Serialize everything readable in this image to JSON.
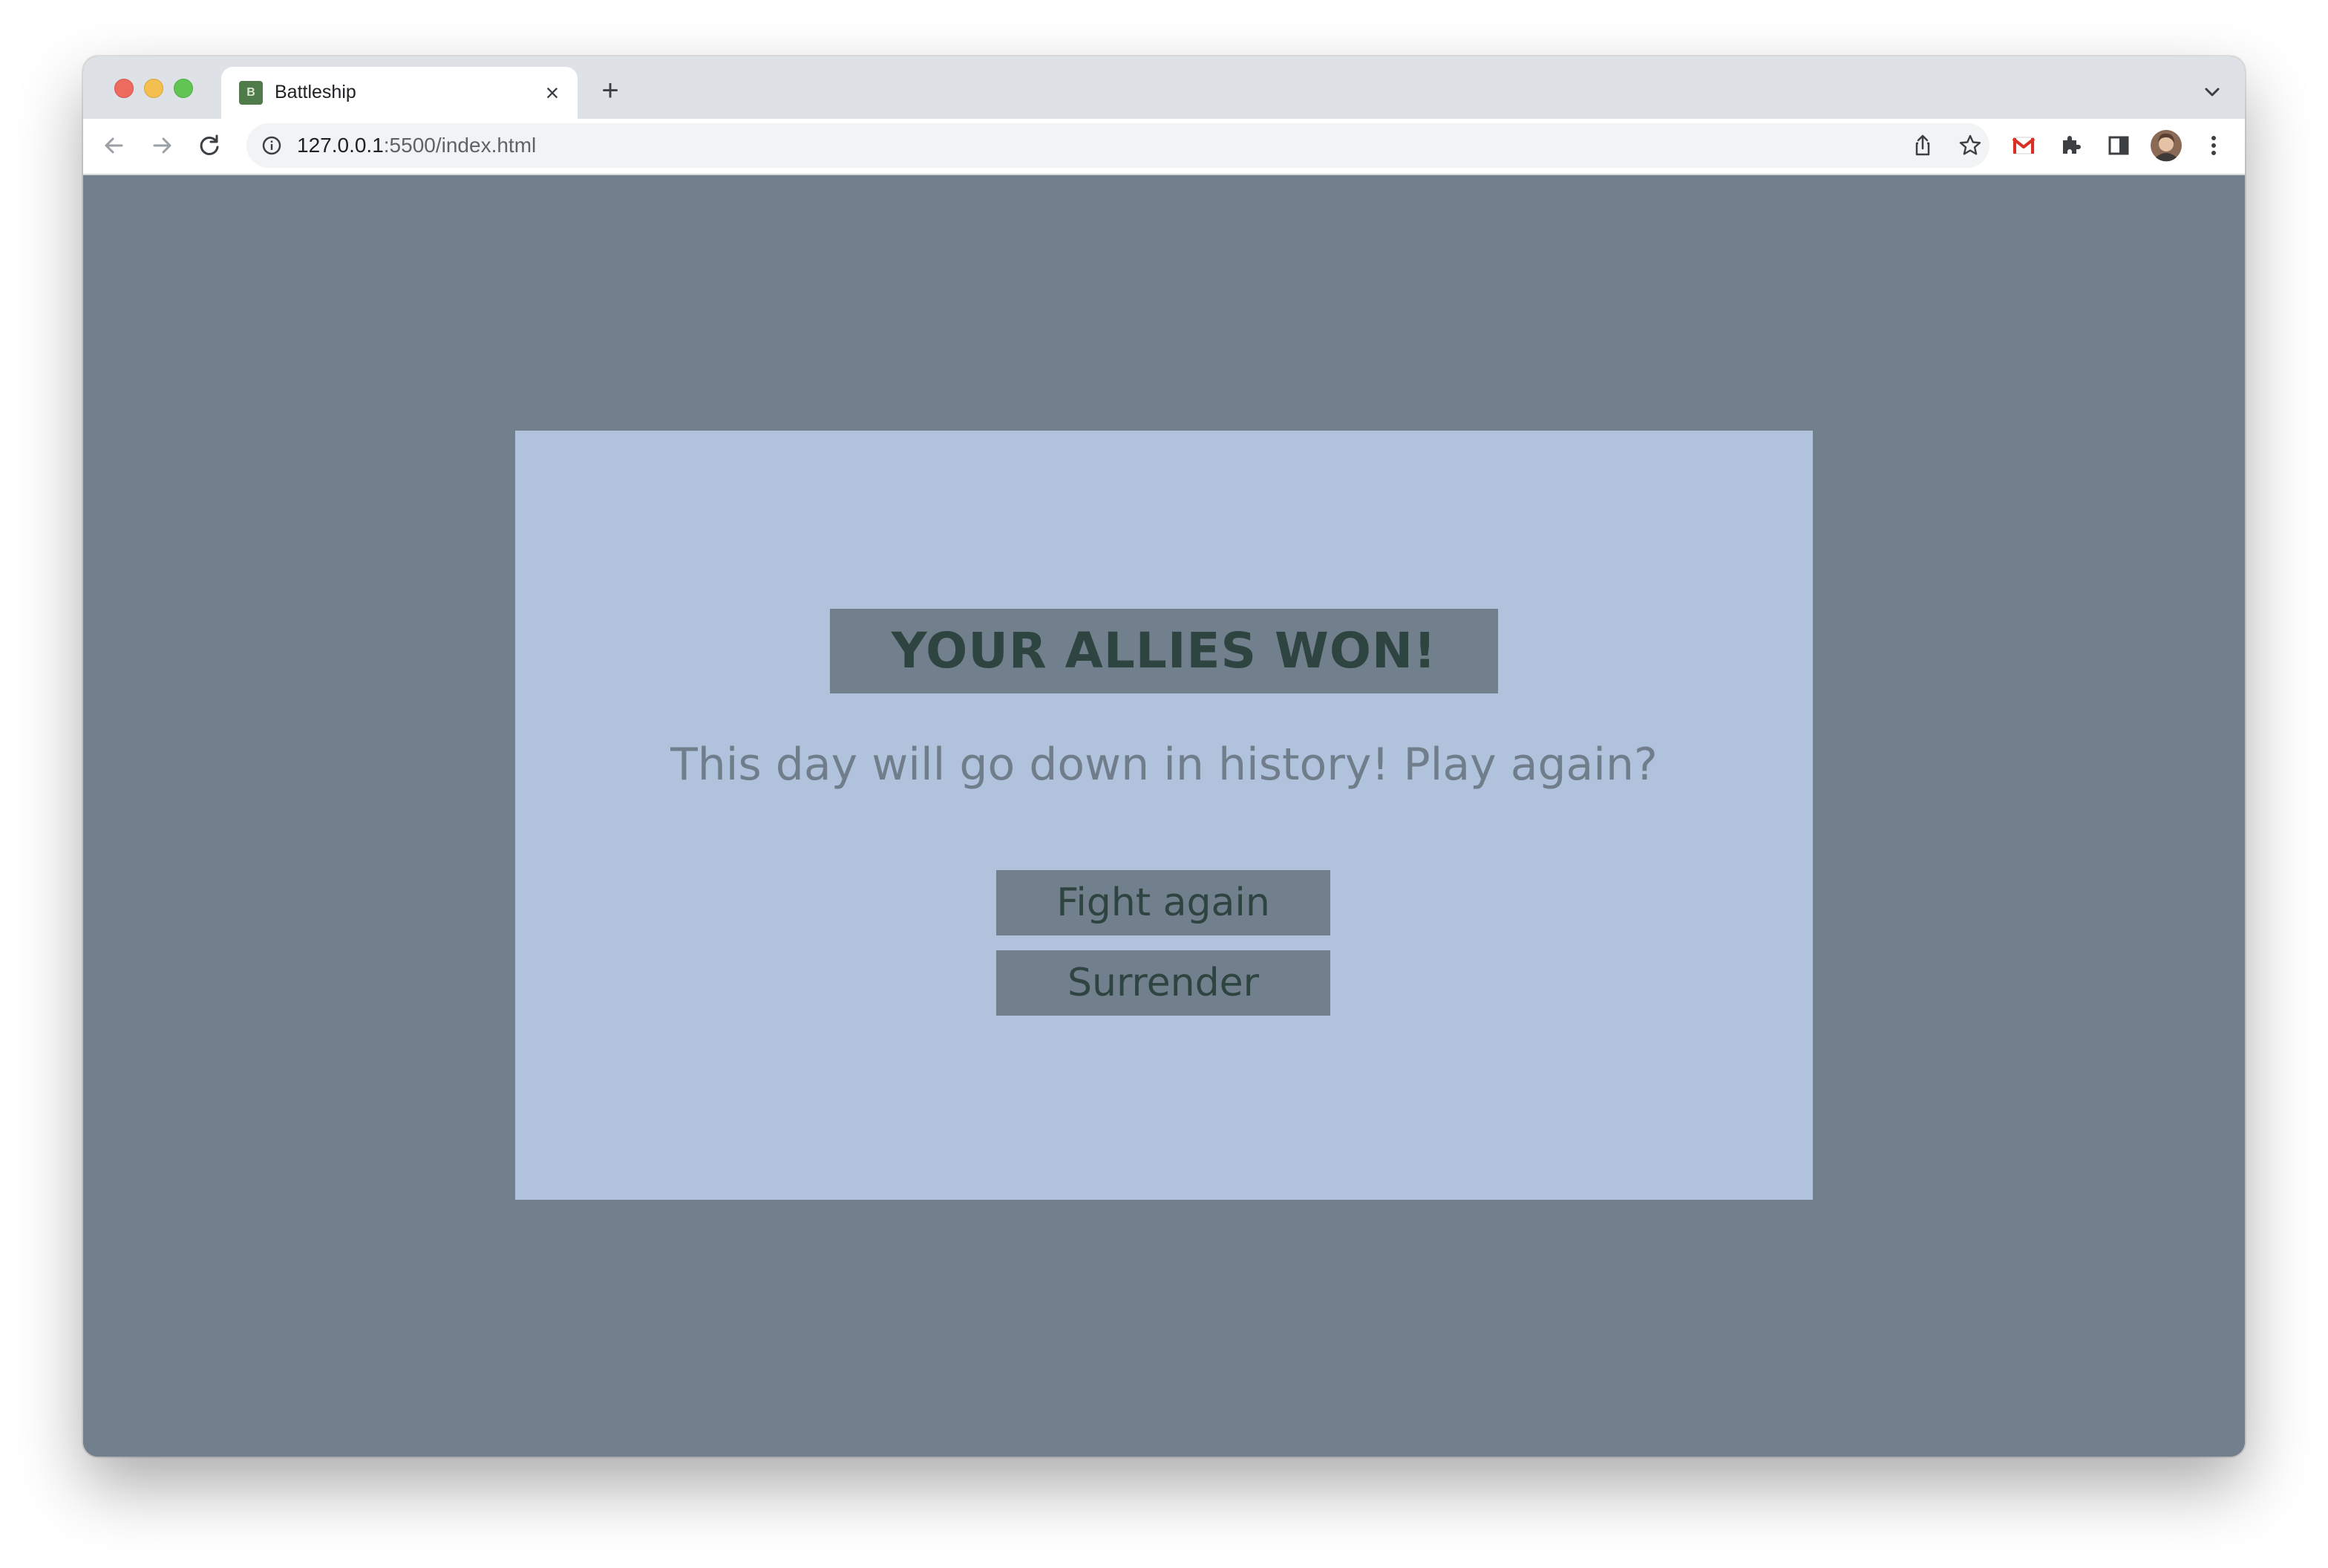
{
  "browser": {
    "tab_title": "Battleship",
    "favicon_letter": "B",
    "close_glyph": "×",
    "new_tab_glyph": "+",
    "url_host": "127.0.0.1",
    "url_rest": ":5500/index.html",
    "icons": [
      "back-icon",
      "forward-icon",
      "reload-icon",
      "info-icon",
      "share-icon",
      "star-icon",
      "gmail-icon",
      "extensions-icon",
      "sidebar-icon",
      "avatar",
      "menu-icon",
      "tab-list-icon"
    ]
  },
  "game": {
    "result_title": "YOUR ALLIES WON!",
    "message": "This day will go down in history! Play again?",
    "fight_again_label": "Fight again",
    "surrender_label": "Surrender"
  },
  "colors": {
    "page_background": "#727f8c",
    "modal_background": "#b1c2dc",
    "button_background": "#727f8c",
    "button_text": "#2d4440",
    "message_text": "#707d8b"
  }
}
